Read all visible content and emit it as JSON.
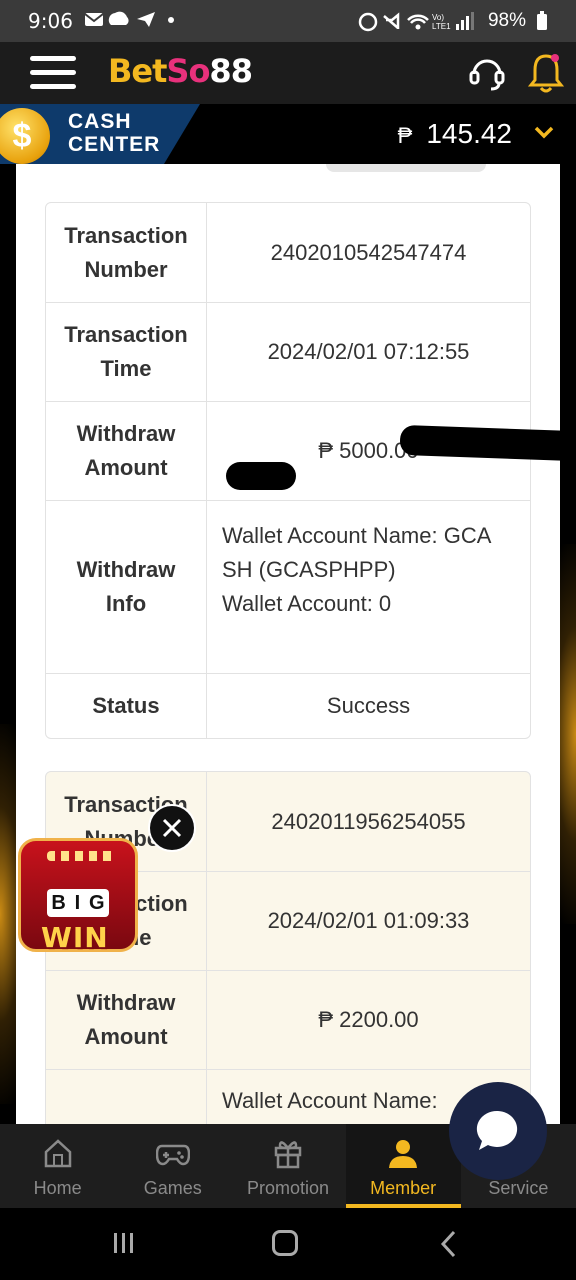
{
  "status_bar": {
    "time": "9:06",
    "battery": "98%"
  },
  "header": {
    "logo_bet": "Bet",
    "logo_so": "So",
    "logo_88": "88"
  },
  "cash_center": {
    "label_line1": "CASH",
    "label_line2": "CENTER",
    "currency_symbol": "₱",
    "balance": "145.42"
  },
  "transactions": [
    {
      "labels": {
        "number": "Transaction Number",
        "time": "Transaction Time",
        "amount": "Withdraw Amount",
        "info": "Withdraw Info",
        "status": "Status"
      },
      "number": "2402010542547474",
      "time": "2024/02/01 07:12:55",
      "amount": "₱ 5000.00",
      "info_line1": "Wallet Account Name: GCA SH (GCASPHPP)",
      "info_line2": "Wallet Account: 0",
      "status": "Success"
    },
    {
      "labels": {
        "number": "Transaction Number",
        "time": "Transaction Time",
        "amount": "Withdraw Amount"
      },
      "number": "2402011956254055",
      "time": "2024/02/01 01:09:33",
      "amount": "₱ 2200.00",
      "info_line1": "Wallet Account Name: "
    }
  ],
  "promo": {
    "reel_letters": [
      "B",
      "I",
      "G"
    ],
    "win_text": "WIN"
  },
  "bottom_nav": [
    {
      "label": "Home",
      "icon": "home-icon"
    },
    {
      "label": "Games",
      "icon": "gamepad-icon"
    },
    {
      "label": "Promotion",
      "icon": "gift-icon"
    },
    {
      "label": "Member",
      "icon": "member-icon",
      "active": true
    },
    {
      "label": "Service",
      "icon": "service-icon"
    }
  ],
  "colors": {
    "accent": "#f3b820",
    "cash_center_blue": "#0e3a6b",
    "second_card_bg": "#fbf7ea"
  }
}
